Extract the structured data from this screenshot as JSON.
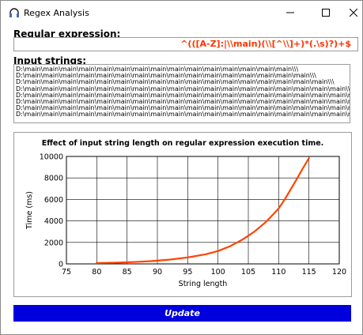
{
  "window": {
    "title": "Regex Analysis",
    "app_icon": "headphones-icon"
  },
  "labels": {
    "regex": "Regular expression:",
    "input": "Input strings:"
  },
  "regex": {
    "value": "^(([A-Z]:|\\\\main)(\\\\[^\\\\]+)*(.\\s)?)+$"
  },
  "input_strings": [
    "D:\\main\\main\\main\\main\\main\\main\\main\\main\\main\\main\\main\\main\\main\\main\\main\\\\\\",
    "D:\\main\\main\\main\\main\\main\\main\\main\\main\\main\\main\\main\\main\\main\\main\\main\\main\\\\\\",
    "D:\\main\\main\\main\\main\\main\\main\\main\\main\\main\\main\\main\\main\\main\\main\\main\\main\\main\\\\\\",
    "D:\\main\\main\\main\\main\\main\\main\\main\\main\\main\\main\\main\\main\\main\\main\\main\\main\\main\\main\\\\\\",
    "D:\\main\\main\\main\\main\\main\\main\\main\\main\\main\\main\\main\\main\\main\\main\\main\\main\\main\\main\\main\\\\\\",
    "D:\\main\\main\\main\\main\\main\\main\\main\\main\\main\\main\\main\\main\\main\\main\\main\\main\\main\\main\\main\\main\\\\\\",
    "D:\\main\\main\\main\\main\\main\\main\\main\\main\\main\\main\\main\\main\\main\\main\\main\\main\\main\\main\\main\\main\\main\\\\\\",
    "D:\\main\\main\\main\\main\\main\\main\\main\\main\\main\\main\\main\\main\\main\\main\\main\\main\\main\\main\\main\\main\\main\\main\\\\\\"
  ],
  "chart_data": {
    "type": "line",
    "title": "Effect of input string length on regular expression execution time.",
    "xlabel": "String length",
    "ylabel": "Time (ms)",
    "xlim": [
      75,
      120
    ],
    "ylim": [
      0,
      10000
    ],
    "xticks": [
      "75",
      "80",
      "85",
      "90",
      "95",
      "100",
      "105",
      "110",
      "115",
      "120"
    ],
    "yticks": [
      "0",
      "2000",
      "4000",
      "6000",
      "8000",
      "10000"
    ],
    "grid": true,
    "series": [
      {
        "color": "#ff4400",
        "x": [
          80,
          83,
          86,
          89,
          92,
          95,
          98,
          100,
          102,
          104,
          106,
          108,
          110,
          111,
          112,
          113,
          114,
          115
        ],
        "y": [
          80,
          110,
          170,
          260,
          400,
          600,
          900,
          1200,
          1650,
          2250,
          3000,
          3950,
          5150,
          6000,
          6950,
          7900,
          8900,
          9850
        ]
      }
    ]
  },
  "buttons": {
    "update": "Update"
  },
  "colors": {
    "regex_text": "#ff3300",
    "update_button": "#0000dd",
    "series_line": "#ff4400"
  }
}
